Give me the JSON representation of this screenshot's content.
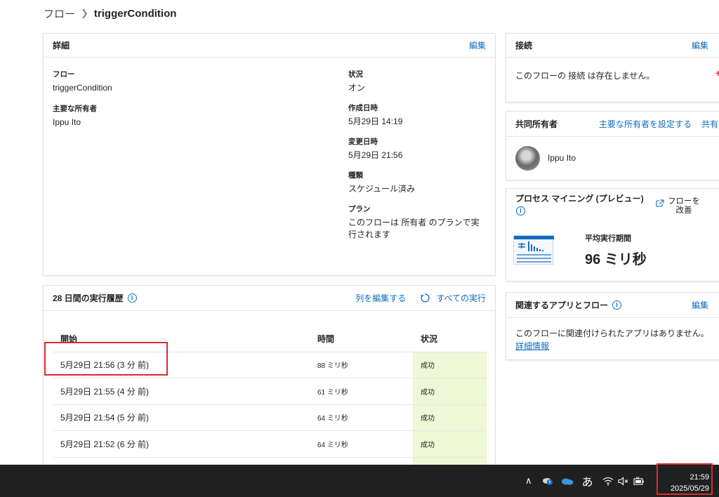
{
  "breadcrumb": {
    "root": "フロー",
    "current": "triggerCondition"
  },
  "details": {
    "title": "詳細",
    "edit": "編集",
    "flow_label": "フロー",
    "flow_value": "triggerCondition",
    "owner_label": "主要な所有者",
    "owner_value": "Ippu Ito",
    "status_label": "状況",
    "status_value": "オン",
    "created_label": "作成日時",
    "created_value": "5月29日 14:19",
    "modified_label": "変更日時",
    "modified_value": "5月29日 21:56",
    "type_label": "種類",
    "type_value": "スケジュール済み",
    "plan_label": "プラン",
    "plan_value": "このフローは 所有者 のプランで実行されます"
  },
  "history": {
    "title": "28 日間の実行履歴",
    "edit_columns": "列を編集する",
    "all_runs": "すべての実行",
    "columns": [
      "開始",
      "時間",
      "状況"
    ],
    "rows": [
      {
        "start": "5月29日 21:56 (3 分 前)",
        "duration": "88 ミリ秒",
        "status": "成功"
      },
      {
        "start": "5月29日 21:55 (4 分 前)",
        "duration": "61 ミリ秒",
        "status": "成功"
      },
      {
        "start": "5月29日 21:54 (5 分 前)",
        "duration": "64 ミリ秒",
        "status": "成功"
      },
      {
        "start": "5月29日 21:52 (6 分 前)",
        "duration": "64 ミリ秒",
        "status": "成功"
      }
    ]
  },
  "connections": {
    "title": "接続",
    "edit": "編集",
    "empty": "このフローの 接続 は存在しません。"
  },
  "coowners": {
    "title": "共同所有者",
    "set_owner": "主要な所有者を設定する",
    "share": "共有",
    "member": "Ippu Ito"
  },
  "process_mining": {
    "title": "プロセス マイニング (プレビュー)",
    "improve": "フローを改善",
    "metric_label": "平均実行期間",
    "metric_value": "96 ミリ秒"
  },
  "related": {
    "title": "関連するアプリとフロー",
    "edit": "編集",
    "empty": "このフローに関連付けられたアプリはありません。",
    "more": "詳細情報"
  },
  "taskbar": {
    "ime": "あ",
    "time": "21:59",
    "date": "2025/05/29"
  },
  "colors": {
    "accent": "#0f6cbd",
    "success_bg": "#eef7d6",
    "highlight": "#e0292b",
    "taskbar": "#202020"
  }
}
